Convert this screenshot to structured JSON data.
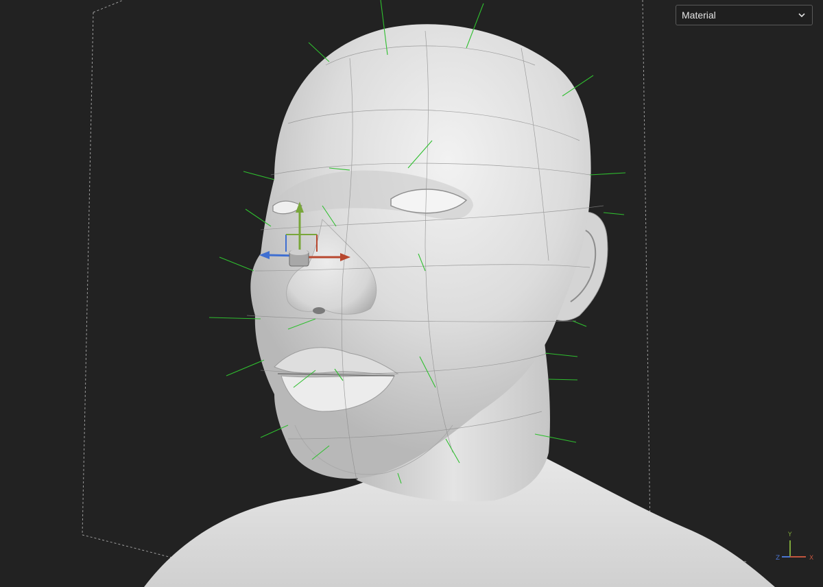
{
  "viewport": {
    "shading_dropdown": {
      "selected": "Material",
      "icon": "chevron-down-icon"
    },
    "axis_triad": {
      "y_label": "Y",
      "x_label": "X",
      "z_label": "Z",
      "colors": {
        "x": "#c2553e",
        "y": "#7ea63a",
        "z": "#4c76d2"
      }
    },
    "gizmo": {
      "icon": "transform-gizmo-icon",
      "colors": {
        "x": "#b8482f",
        "y": "#79a63b",
        "z": "#3f6fd1"
      }
    },
    "model": {
      "icon": "head-sculpt-mesh",
      "normal_line_color": "#2fbf2f"
    },
    "background_color": "#222222"
  }
}
